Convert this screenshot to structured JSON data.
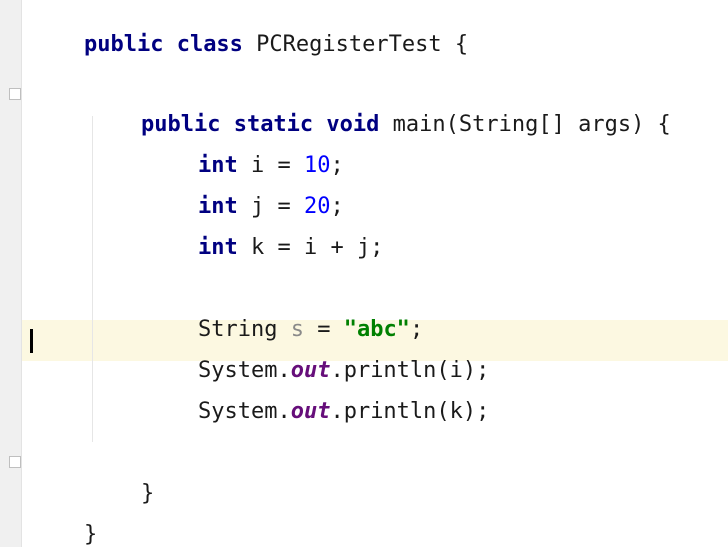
{
  "code": {
    "line1": {
      "kw": "public class",
      "rest": " PCRegisterTest {"
    },
    "line2": {
      "kw": "public static void",
      "rest": " main(String[] args) {"
    },
    "line3": {
      "kw": "int",
      "pre": " i = ",
      "num": "10",
      "post": ";"
    },
    "line4": {
      "kw": "int",
      "pre": " j = ",
      "num": "20",
      "post": ";"
    },
    "line5": {
      "kw": "int",
      "rest": " k = i + j;"
    },
    "line6": {
      "type": "String ",
      "var": "s",
      "eq": " = ",
      "str": "\"abc\"",
      "post": ";"
    },
    "line7": {
      "obj": "System.",
      "field": "out",
      "call": ".println(i);"
    },
    "line8": {
      "obj": "System.",
      "field": "out",
      "call": ".println(k);"
    },
    "line9": {
      "text": "}"
    },
    "line10": {
      "text": "}"
    }
  },
  "colors": {
    "keyword": "#000080",
    "number": "#0000ff",
    "string": "#008000",
    "static_field": "#660e7a",
    "current_line": "#fcf8e1"
  }
}
